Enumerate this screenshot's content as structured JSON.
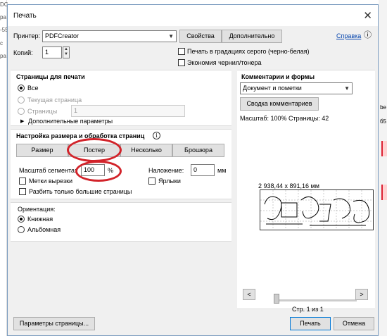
{
  "background": {
    "left_texts": [
      "DC",
      "ра",
      "-55",
      "с",
      "ра"
    ],
    "right_texts": [
      "be",
      "б5"
    ]
  },
  "dialog": {
    "title": "Печать",
    "close_glyph": "✕"
  },
  "printer": {
    "label": "Принтер:",
    "value": "PDFCreator",
    "properties_button": "Свойства",
    "advanced_button": "Дополнительно",
    "help_link": "Справка"
  },
  "copies": {
    "label": "Копий:",
    "value": "1"
  },
  "options": {
    "grayscale": "Печать в градациях серого (черно-белая)",
    "save_ink": "Экономия чернил/тонера"
  },
  "pages": {
    "heading": "Страницы для печати",
    "all": "Все",
    "current": "Текущая страница",
    "pages": "Страницы",
    "pages_value": "1",
    "more": "Дополнительные параметры"
  },
  "sizing": {
    "heading": "Настройка размера и обработка страниц",
    "info": "i",
    "size_button": "Размер",
    "poster_button": "Постер",
    "multiple_button": "Несколько",
    "booklet_button": "Брошюра",
    "tile_scale_label": "Масштаб сегмента:",
    "tile_scale_value": "100",
    "tile_scale_unit": "%",
    "overlap_label": "Наложение:",
    "overlap_value": "0",
    "overlap_unit": "мм",
    "cut_marks": "Метки вырезки",
    "labels": "Ярлыки",
    "tile_large_only": "Разбить только большие страницы"
  },
  "orientation": {
    "heading": "Ориентация:",
    "portrait": "Книжная",
    "landscape": "Альбомная"
  },
  "comments": {
    "heading": "Комментарии и формы",
    "selected": "Документ и пометки",
    "summary_button": "Сводка комментариев",
    "scale_info": "Масштаб: 100% Страницы: 42"
  },
  "preview": {
    "dimensions": "2 938,44 x 891,16 мм",
    "page_counter": "Стр. 1 из 1",
    "prev": "<",
    "next": ">"
  },
  "footer": {
    "page_setup_button": "Параметры страницы...",
    "print_button": "Печать",
    "cancel_button": "Отмена"
  },
  "colors": {
    "annotation_red": "#d2232a",
    "link_blue": "#0645ad",
    "primary_border": "#0078d7"
  }
}
